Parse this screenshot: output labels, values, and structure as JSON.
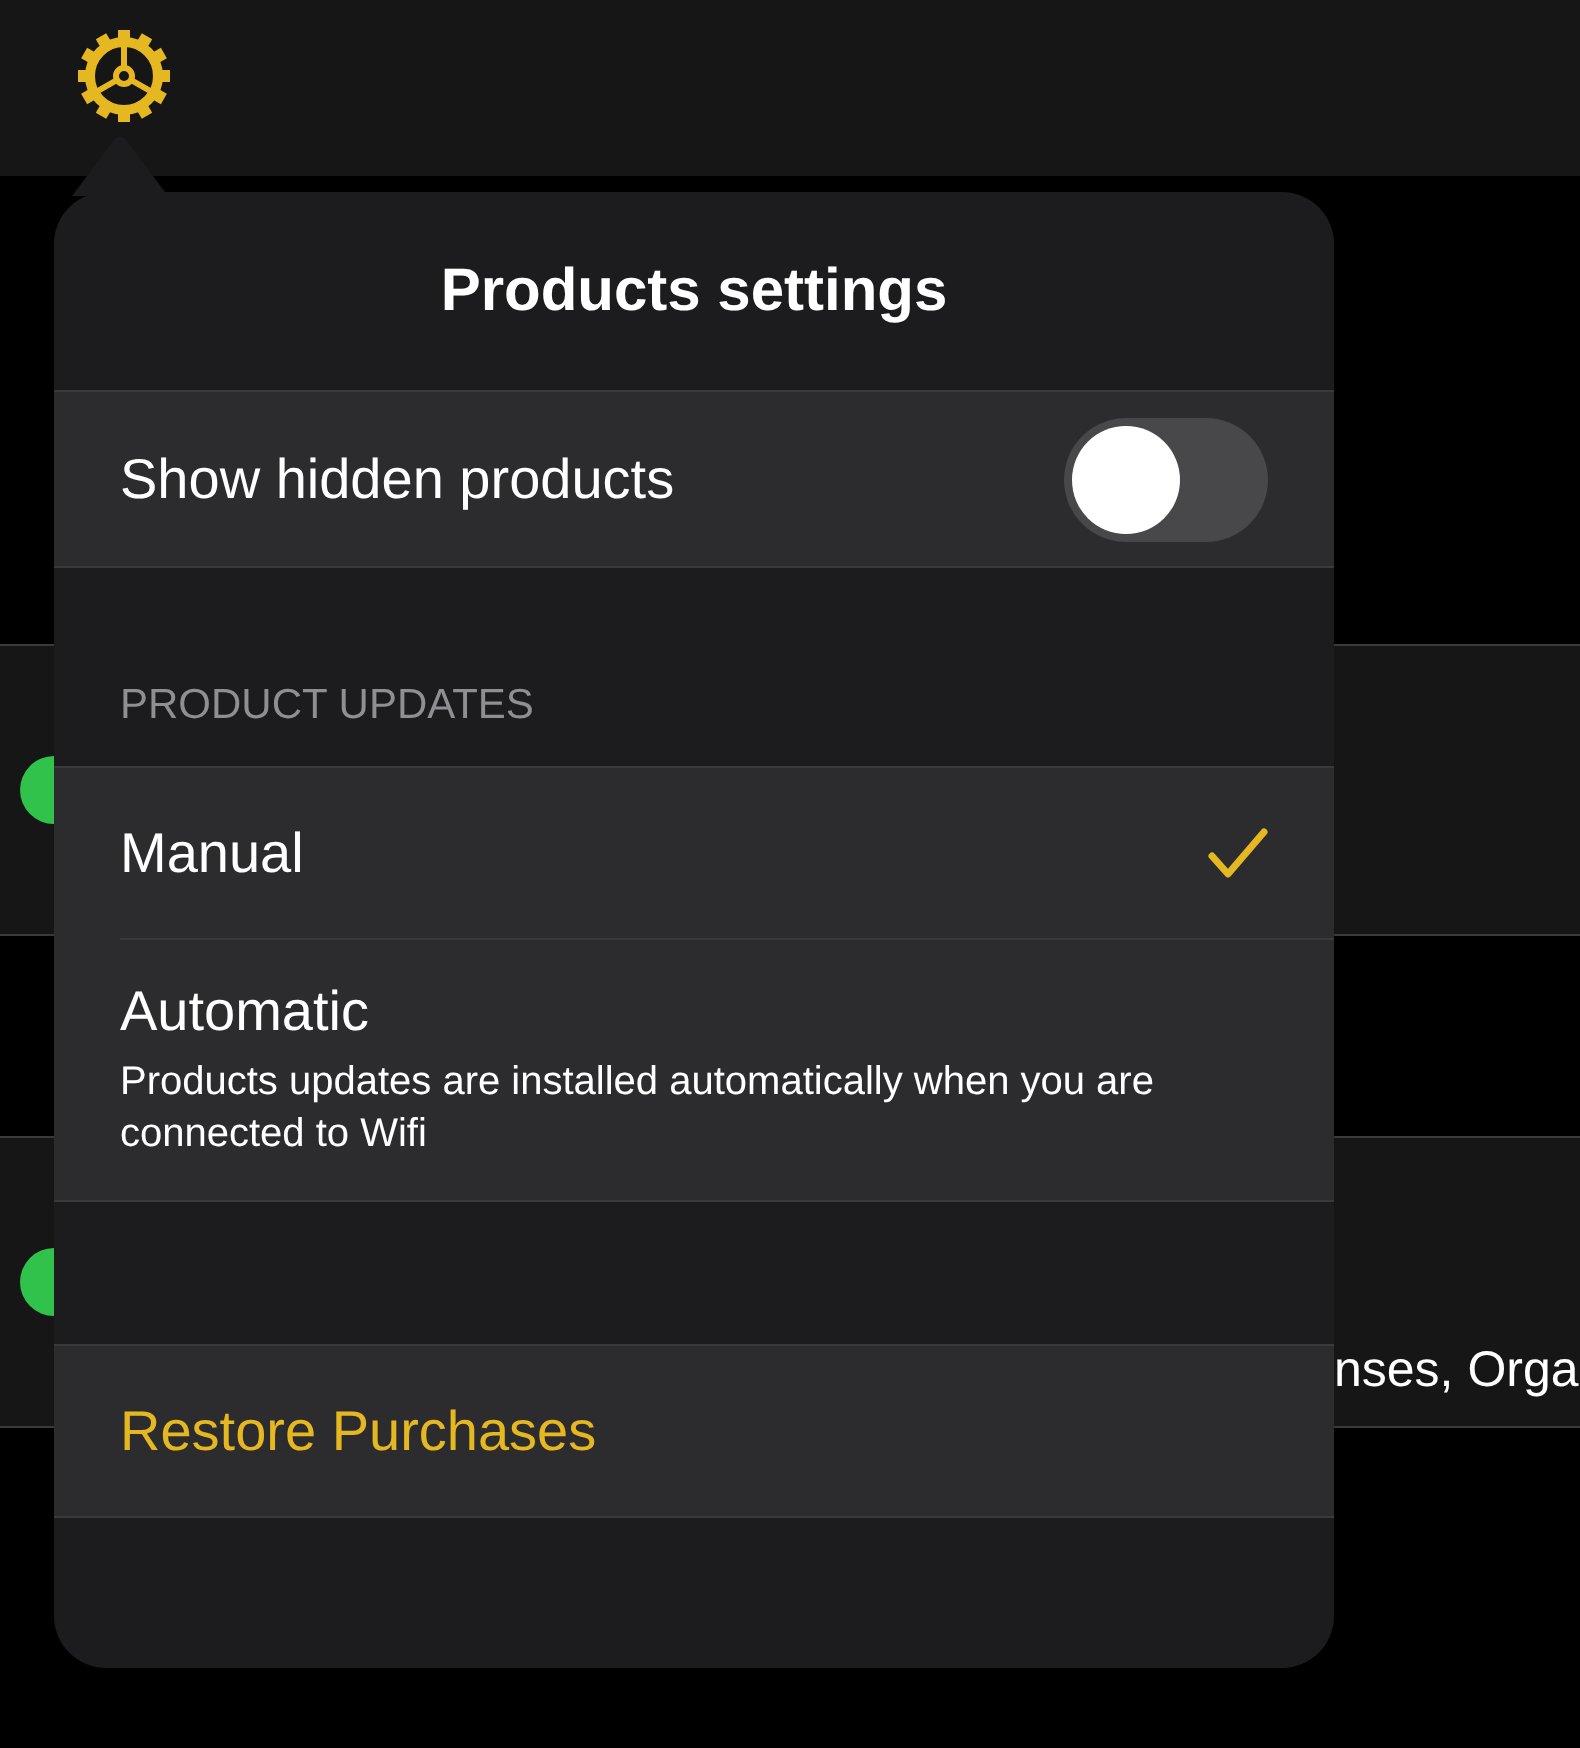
{
  "background": {
    "rows": [
      {
        "color": "#30c24a",
        "detail": ""
      },
      {
        "color": "#30c24a",
        "detail": "nses, Orga"
      }
    ]
  },
  "popover": {
    "title": "Products settings",
    "toggle": {
      "label": "Show hidden products",
      "on": false
    },
    "section_header": "PRODUCT UPDATES",
    "options": [
      {
        "label": "Manual",
        "selected": true
      },
      {
        "label": "Automatic",
        "description": "Products updates are installed automatically when you are connected to Wifi",
        "selected": false
      }
    ],
    "action": "Restore Purchases"
  }
}
